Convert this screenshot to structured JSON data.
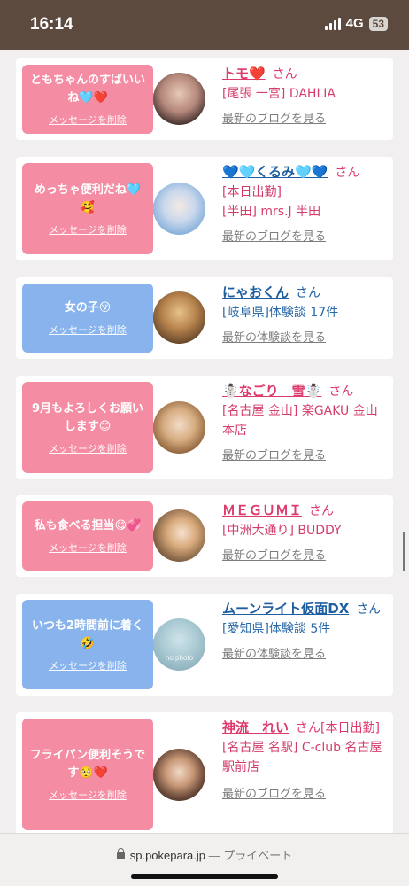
{
  "status": {
    "time": "16:14",
    "network": "4G",
    "battery": "53"
  },
  "browser": {
    "url": "sp.pokepara.jp",
    "privacy": "— プライベート"
  },
  "delete_label": "メッセージを削除",
  "cards": [
    {
      "message": "ともちゃんのすばいいね🩵❤️",
      "name": "トモ❤️",
      "suffix": "さん",
      "details": [
        "[尾張 一宮] DAHLIA"
      ],
      "link": "最新のブログを見る"
    },
    {
      "message": "めっちゃ便利だね🩵🥰",
      "name": "💙🩵くるみ🩵💙",
      "suffix": "さん",
      "details": [
        "[本日出勤]",
        "[半田] mrs.J 半田"
      ],
      "link": "最新のブログを見る"
    },
    {
      "message": "女の子😚",
      "name": "にゃおくん",
      "suffix": "さん",
      "details": [
        "[岐阜県]体験談 17件"
      ],
      "link": "最新の体験談を見る"
    },
    {
      "message": "9月もよろしくお願いします😊",
      "name": "☃️なごり　雪☃️",
      "suffix": "さん",
      "details": [
        "[名古屋 金山] 楽GAKU 金山本店"
      ],
      "link": "最新のブログを見る"
    },
    {
      "message": "私も食べる担当😋💞",
      "name": "ＭＥＧＵＭＩ",
      "suffix": "さん",
      "details": [
        "[中洲大通り] BUDDY"
      ],
      "link": "最新のブログを見る"
    },
    {
      "message": "いつも2時間前に着く🤣",
      "name": "ムーンライト仮面DX",
      "suffix": "さん",
      "details": [
        "[愛知県]体験談 5件"
      ],
      "link": "最新の体験談を見る",
      "avatar_text": "no photo"
    },
    {
      "message": "フライパン便利そうです🥺❤️",
      "name": "神流　れい",
      "suffix": "さん[本日出勤]",
      "details": [
        "[名古屋 名駅] C-club 名古屋駅前店"
      ],
      "link": "最新のブログを見る"
    }
  ]
}
